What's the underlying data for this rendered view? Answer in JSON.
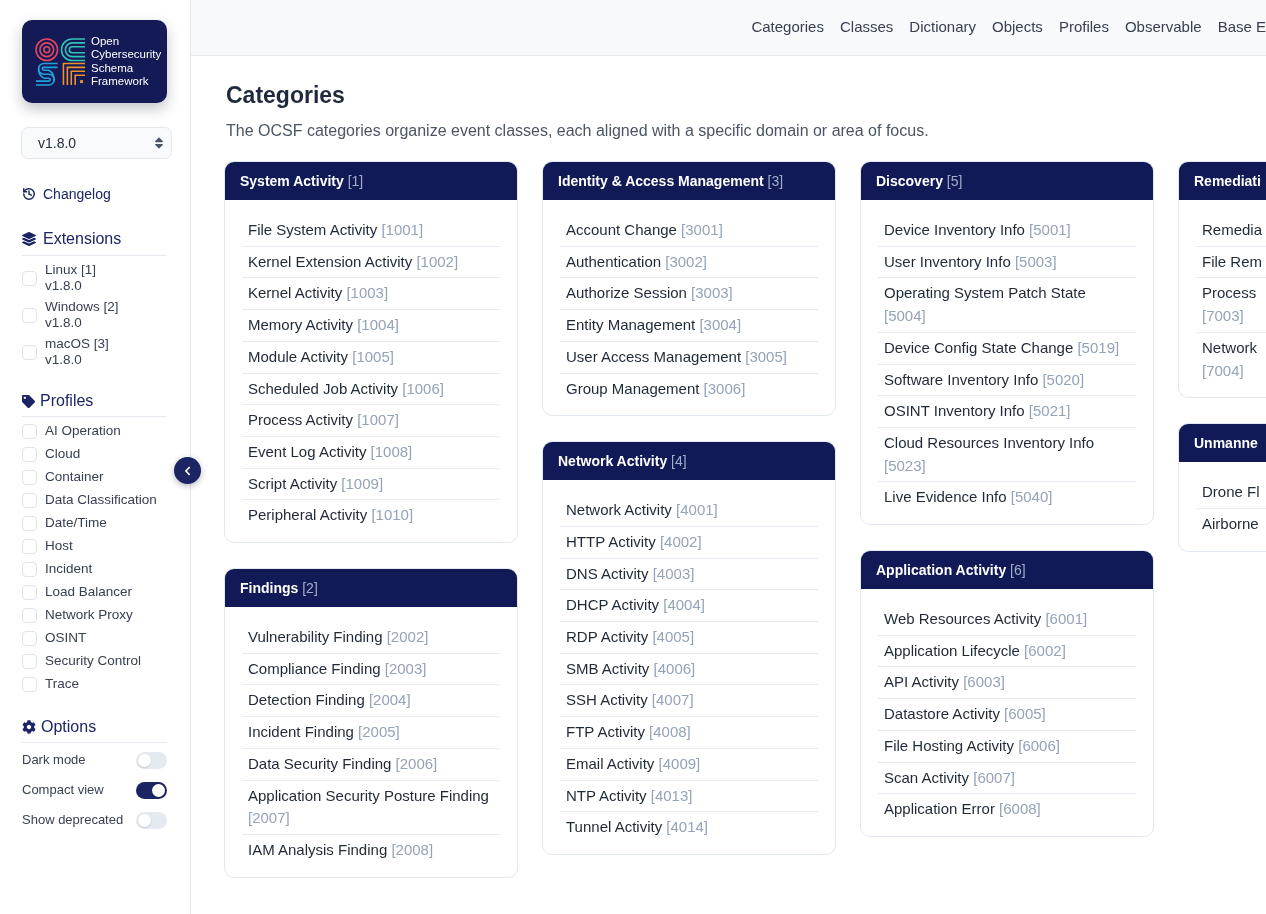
{
  "sidebar": {
    "logo": {
      "lines": [
        "Open",
        "Cybersecurity",
        "Schema",
        "Framework"
      ]
    },
    "version_select": {
      "value": "v1.8.0"
    },
    "changelog": "Changelog",
    "extensions": {
      "title": "Extensions",
      "items": [
        {
          "label": "Linux [1]",
          "version": "v1.8.0",
          "checked": false
        },
        {
          "label": "Windows [2]",
          "version": "v1.8.0",
          "checked": false
        },
        {
          "label": "macOS [3]",
          "version": "v1.8.0",
          "checked": false
        }
      ]
    },
    "profiles": {
      "title": "Profiles",
      "items": [
        {
          "label": "AI Operation",
          "checked": false
        },
        {
          "label": "Cloud",
          "checked": false
        },
        {
          "label": "Container",
          "checked": false
        },
        {
          "label": "Data Classification",
          "checked": false
        },
        {
          "label": "Date/Time",
          "checked": false
        },
        {
          "label": "Host",
          "checked": false
        },
        {
          "label": "Incident",
          "checked": false
        },
        {
          "label": "Load Balancer",
          "checked": false
        },
        {
          "label": "Network Proxy",
          "checked": false
        },
        {
          "label": "OSINT",
          "checked": false
        },
        {
          "label": "Security Control",
          "checked": false
        },
        {
          "label": "Trace",
          "checked": false
        }
      ]
    },
    "options": {
      "title": "Options",
      "items": [
        {
          "label": "Dark mode",
          "on": false
        },
        {
          "label": "Compact view",
          "on": true
        },
        {
          "label": "Show deprecated",
          "on": false
        }
      ]
    }
  },
  "nav": [
    "Categories",
    "Classes",
    "Dictionary",
    "Objects",
    "Profiles",
    "Observable",
    "Base E"
  ],
  "page": {
    "title": "Categories",
    "description": "The OCSF categories organize event classes, each aligned with a specific domain or area of focus."
  },
  "columns": [
    [
      {
        "name": "System Activity",
        "id": "[1]",
        "classes": [
          {
            "name": "File System Activity",
            "id": "[1001]"
          },
          {
            "name": "Kernel Extension Activity",
            "id": "[1002]"
          },
          {
            "name": "Kernel Activity",
            "id": "[1003]"
          },
          {
            "name": "Memory Activity",
            "id": "[1004]"
          },
          {
            "name": "Module Activity",
            "id": "[1005]"
          },
          {
            "name": "Scheduled Job Activity",
            "id": "[1006]"
          },
          {
            "name": "Process Activity",
            "id": "[1007]"
          },
          {
            "name": "Event Log Activity",
            "id": "[1008]"
          },
          {
            "name": "Script Activity",
            "id": "[1009]"
          },
          {
            "name": "Peripheral Activity",
            "id": "[1010]"
          }
        ]
      },
      {
        "name": "Findings",
        "id": "[2]",
        "classes": [
          {
            "name": "Vulnerability Finding",
            "id": "[2002]"
          },
          {
            "name": "Compliance Finding",
            "id": "[2003]"
          },
          {
            "name": "Detection Finding",
            "id": "[2004]"
          },
          {
            "name": "Incident Finding",
            "id": "[2005]"
          },
          {
            "name": "Data Security Finding",
            "id": "[2006]"
          },
          {
            "name": "Application Security Posture Finding",
            "id": "[2007]"
          },
          {
            "name": "IAM Analysis Finding",
            "id": "[2008]"
          }
        ]
      }
    ],
    [
      {
        "name": "Identity & Access Management",
        "id": "[3]",
        "classes": [
          {
            "name": "Account Change",
            "id": "[3001]"
          },
          {
            "name": "Authentication",
            "id": "[3002]"
          },
          {
            "name": "Authorize Session",
            "id": "[3003]"
          },
          {
            "name": "Entity Management",
            "id": "[3004]"
          },
          {
            "name": "User Access Management",
            "id": "[3005]"
          },
          {
            "name": "Group Management",
            "id": "[3006]"
          }
        ]
      },
      {
        "name": "Network Activity",
        "id": "[4]",
        "classes": [
          {
            "name": "Network Activity",
            "id": "[4001]"
          },
          {
            "name": "HTTP Activity",
            "id": "[4002]"
          },
          {
            "name": "DNS Activity",
            "id": "[4003]"
          },
          {
            "name": "DHCP Activity",
            "id": "[4004]"
          },
          {
            "name": "RDP Activity",
            "id": "[4005]"
          },
          {
            "name": "SMB Activity",
            "id": "[4006]"
          },
          {
            "name": "SSH Activity",
            "id": "[4007]"
          },
          {
            "name": "FTP Activity",
            "id": "[4008]"
          },
          {
            "name": "Email Activity",
            "id": "[4009]"
          },
          {
            "name": "NTP Activity",
            "id": "[4013]"
          },
          {
            "name": "Tunnel Activity",
            "id": "[4014]"
          }
        ]
      }
    ],
    [
      {
        "name": "Discovery",
        "id": "[5]",
        "classes": [
          {
            "name": "Device Inventory Info",
            "id": "[5001]"
          },
          {
            "name": "User Inventory Info",
            "id": "[5003]"
          },
          {
            "name": "Operating System Patch State",
            "id": "[5004]"
          },
          {
            "name": "Device Config State Change",
            "id": "[5019]"
          },
          {
            "name": "Software Inventory Info",
            "id": "[5020]"
          },
          {
            "name": "OSINT Inventory Info",
            "id": "[5021]"
          },
          {
            "name": "Cloud Resources Inventory Info",
            "id": "[5023]"
          },
          {
            "name": "Live Evidence Info",
            "id": "[5040]"
          }
        ]
      },
      {
        "name": "Application Activity",
        "id": "[6]",
        "classes": [
          {
            "name": "Web Resources Activity",
            "id": "[6001]"
          },
          {
            "name": "Application Lifecycle",
            "id": "[6002]"
          },
          {
            "name": "API Activity",
            "id": "[6003]"
          },
          {
            "name": "Datastore Activity",
            "id": "[6005]"
          },
          {
            "name": "File Hosting Activity",
            "id": "[6006]"
          },
          {
            "name": "Scan Activity",
            "id": "[6007]"
          },
          {
            "name": "Application Error",
            "id": "[6008]"
          }
        ]
      }
    ],
    [
      {
        "name": "Remediati",
        "classes": [
          {
            "name": "Remedia"
          },
          {
            "name": "File Rem"
          },
          {
            "name": "Process",
            "id": "[7003]"
          },
          {
            "name": "Network",
            "id": "[7004]"
          }
        ]
      },
      {
        "name": "Unmanne",
        "classes": [
          {
            "name": "Drone Fl"
          },
          {
            "name": "Airborne"
          }
        ]
      }
    ]
  ]
}
